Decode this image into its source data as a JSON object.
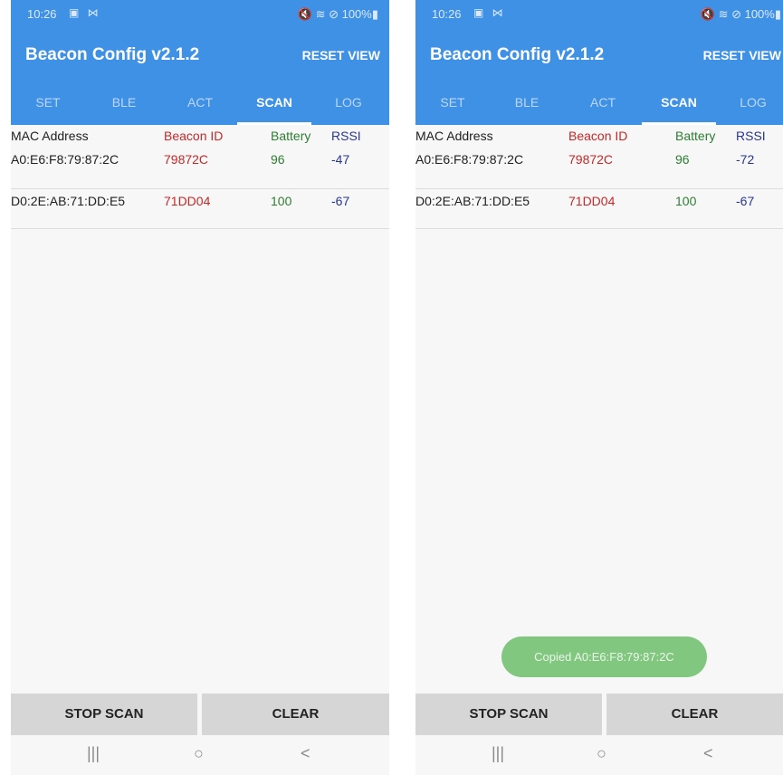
{
  "status_bar": {
    "time": "10:26",
    "left_icons": "▣ ⋈",
    "right_icons": "🔇 ≋ ⊘ 100%▮"
  },
  "app": {
    "title": "Beacon Config v2.1.2",
    "reset_label": "RESET VIEW"
  },
  "tabs": [
    "SET",
    "BLE",
    "ACT",
    "SCAN",
    "LOG"
  ],
  "active_tab": "SCAN",
  "table": {
    "headers": {
      "mac": "MAC Address",
      "id": "Beacon ID",
      "battery": "Battery",
      "rssi": "RSSI"
    },
    "left_rows": [
      {
        "mac": "A0:E6:F8:79:87:2C",
        "id": "79872C",
        "battery": "96",
        "rssi": "-47"
      },
      {
        "mac": "D0:2E:AB:71:DD:E5",
        "id": "71DD04",
        "battery": "100",
        "rssi": "-67"
      }
    ],
    "right_rows": [
      {
        "mac": "A0:E6:F8:79:87:2C",
        "id": "79872C",
        "battery": "96",
        "rssi": "-72"
      },
      {
        "mac": "D0:2E:AB:71:DD:E5",
        "id": "71DD04",
        "battery": "100",
        "rssi": "-67"
      }
    ]
  },
  "buttons": {
    "stop_scan": "STOP SCAN",
    "clear": "CLEAR"
  },
  "nav": {
    "recents": "|||",
    "home": "○",
    "back": "<"
  },
  "toast": "Copied A0:E6:F8:79:87:2C",
  "colors": {
    "primary": "#3f91e6",
    "beacon_id": "#c62828",
    "battery": "#2e7d32",
    "rssi": "#283593",
    "toast": "#82c77f"
  }
}
